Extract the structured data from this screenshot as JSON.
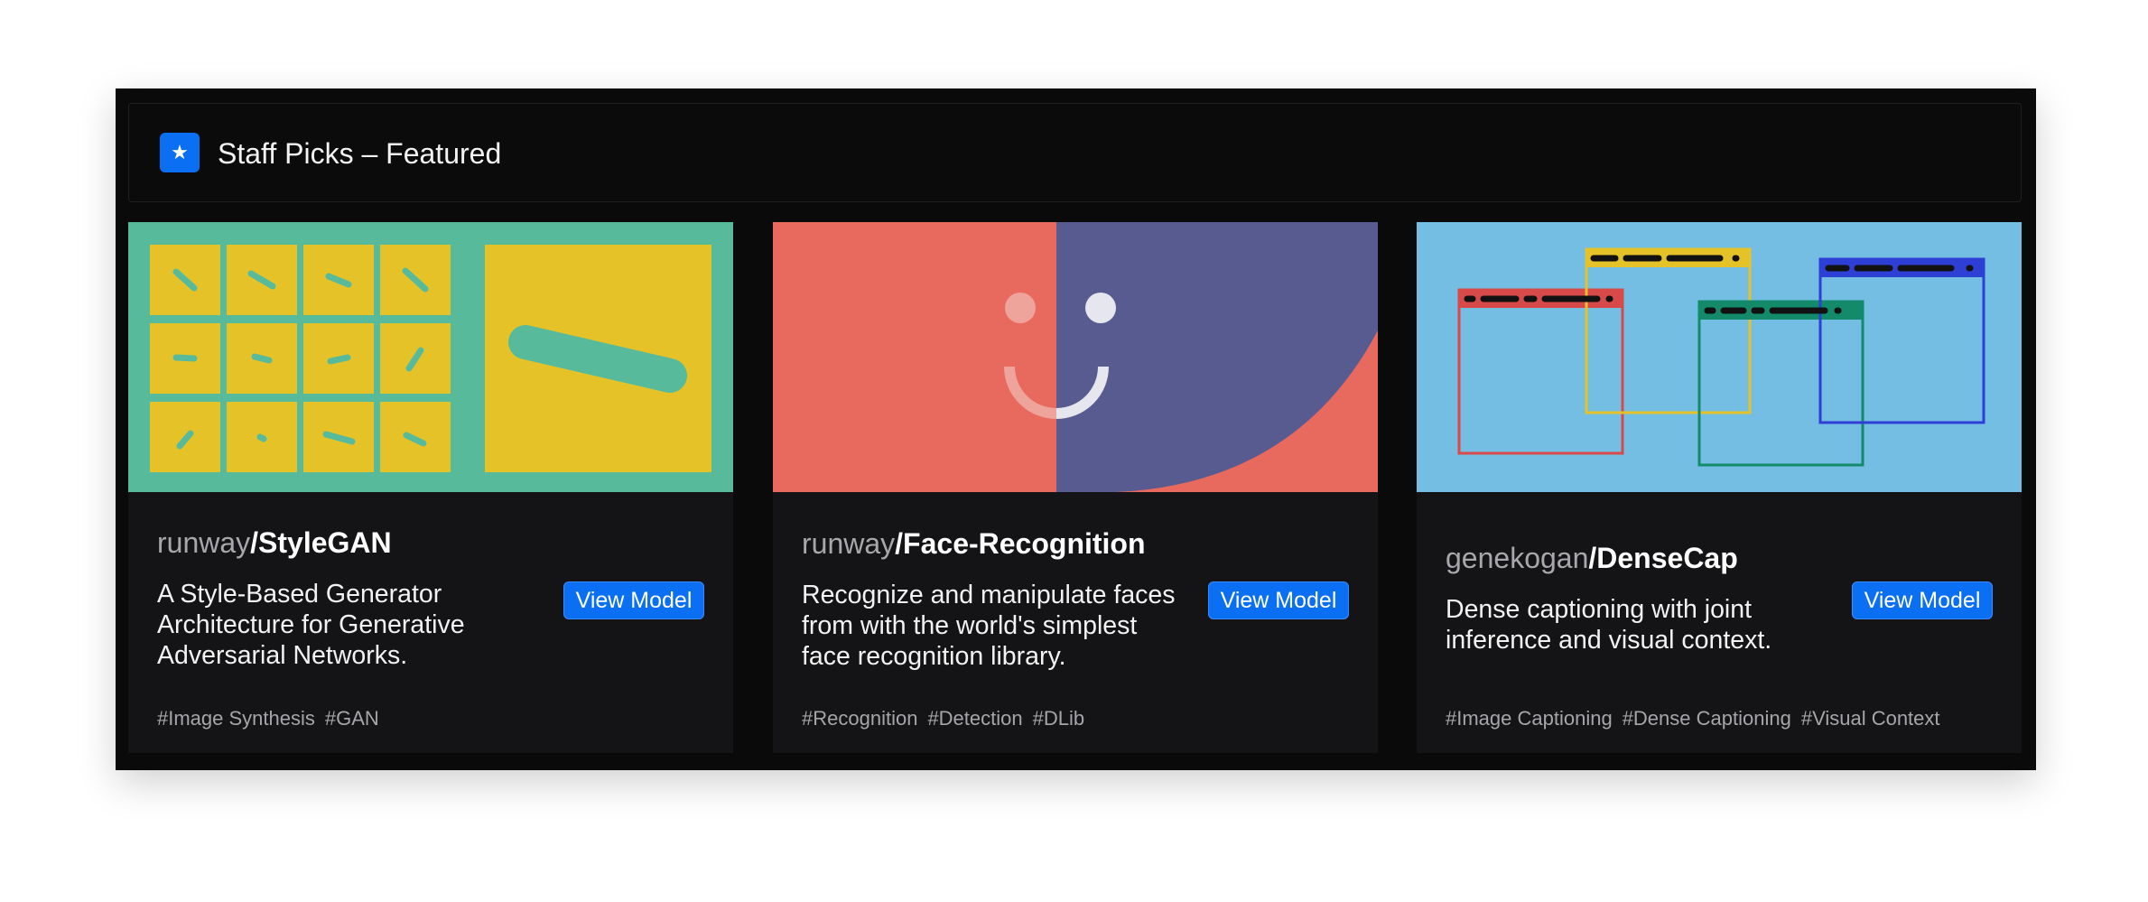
{
  "header": {
    "title": "Staff Picks – Featured",
    "icon": "star-icon",
    "icon_glyph": "★"
  },
  "colors": {
    "accent": "#0a6ff2",
    "panel_bg": "#0a0a0a",
    "card_bg": "#141416",
    "stylegan_green": "#57bb9b",
    "stylegan_yellow": "#e6c229",
    "face_coral": "#e8695d",
    "face_indigo": "#585b8f",
    "densecap_sky": "#74bde3"
  },
  "cards": [
    {
      "owner": "runway",
      "repo": "/StyleGAN",
      "description": "A Style-Based Generator Architecture for Generative Adversarial Networks.",
      "button_label": "View Model",
      "tags": [
        "#Image Synthesis",
        "#GAN"
      ]
    },
    {
      "owner": "runway",
      "repo": "/Face-Recognition",
      "description": "Recognize and manipulate faces from with the world's simplest face recognition library.",
      "button_label": "View Model",
      "tags": [
        "#Recognition",
        "#Detection",
        "#DLib"
      ]
    },
    {
      "owner": "genekogan",
      "repo": "/DenseCap",
      "description": "Dense captioning with joint inference and visual context.",
      "button_label": "View Model",
      "tags": [
        "#Image Captioning",
        "#Dense Captioning",
        "#Visual Context"
      ]
    }
  ]
}
